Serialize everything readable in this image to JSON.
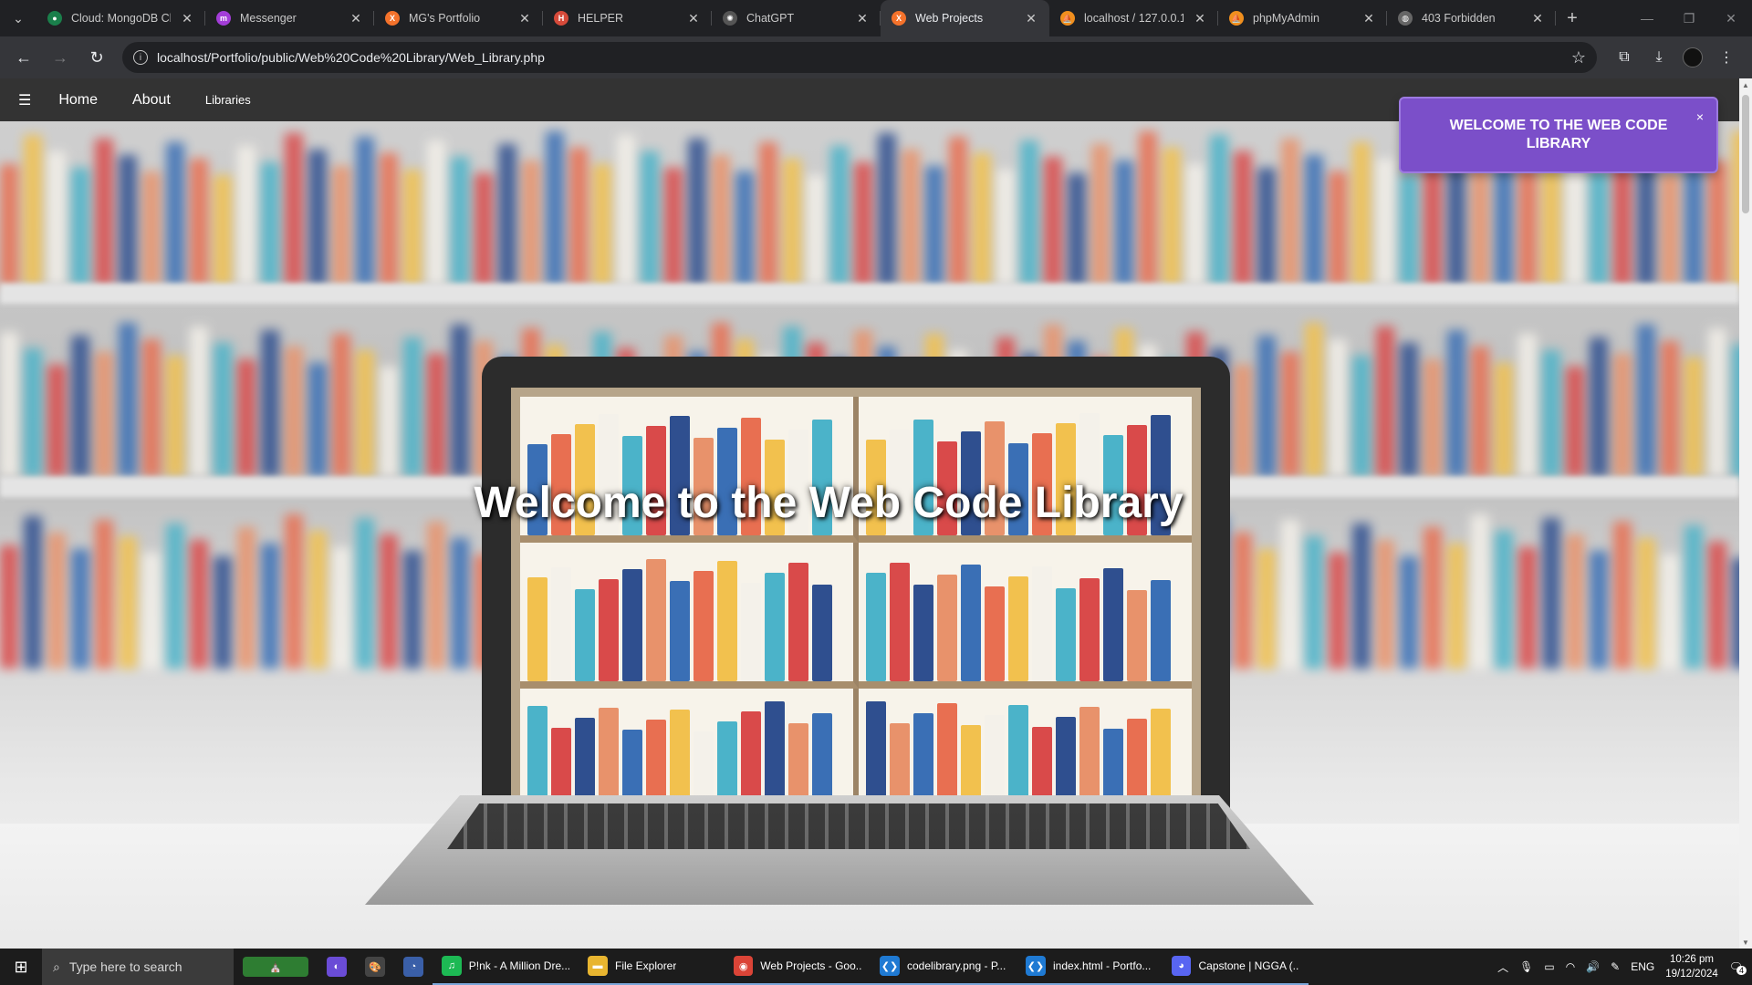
{
  "browser": {
    "tabs": [
      {
        "title": "Cloud: MongoDB Clo",
        "icon": "mongodb-leaf-icon",
        "color": "#1a7f4b",
        "glyph": "●",
        "active": false
      },
      {
        "title": "Messenger",
        "icon": "messenger-icon",
        "color": "#a33dd8",
        "glyph": "m",
        "active": false
      },
      {
        "title": "MG's Portfolio",
        "icon": "xampp-icon",
        "color": "#f4722b",
        "glyph": "X",
        "active": false
      },
      {
        "title": "HELPER",
        "icon": "brave-helper-icon",
        "color": "#d64a3a",
        "glyph": "H",
        "active": false
      },
      {
        "title": "ChatGPT",
        "icon": "chatgpt-icon",
        "color": "#555",
        "glyph": "✺",
        "active": false
      },
      {
        "title": "Web Projects",
        "icon": "xampp-icon",
        "color": "#f4722b",
        "glyph": "X",
        "active": true
      },
      {
        "title": "localhost / 127.0.0.1 /",
        "icon": "phpmyadmin-icon",
        "color": "#f08f1e",
        "glyph": "⛵",
        "active": false
      },
      {
        "title": "phpMyAdmin",
        "icon": "phpmyadmin-icon",
        "color": "#f08f1e",
        "glyph": "⛵",
        "active": false
      },
      {
        "title": "403 Forbidden",
        "icon": "globe-icon",
        "color": "#666",
        "glyph": "◍",
        "active": false
      }
    ],
    "new_tab_label": "+",
    "url": "localhost/Portfolio/public/Web%20Code%20Library/Web_Library.php"
  },
  "site": {
    "nav": {
      "menu_glyph": "☰",
      "home": "Home",
      "about": "About",
      "libraries": "Libraries"
    },
    "hero_title": "Welcome to the Web Code Library",
    "popup": {
      "message": "WELCOME TO THE WEB CODE LIBRARY",
      "close": "×"
    }
  },
  "taskbar": {
    "search_placeholder": "Type here to search",
    "apps": [
      {
        "label": "P!nk - A Million Dre...",
        "icon": "spotify-icon",
        "color": "#1db954",
        "glyph": "♫"
      },
      {
        "label": "File Explorer",
        "icon": "folder-icon",
        "color": "#e8b530",
        "glyph": "▬"
      },
      {
        "label": "Web Projects - Goo...",
        "icon": "chrome-icon",
        "color": "#db4437",
        "glyph": "◉"
      },
      {
        "label": "codelibrary.png - P...",
        "icon": "vscode-icon",
        "color": "#1f7ad3",
        "glyph": "❮❯"
      },
      {
        "label": "index.html - Portfo...",
        "icon": "vscode-icon",
        "color": "#1f7ad3",
        "glyph": "❮❯"
      },
      {
        "label": "Capstone | NGGA (...",
        "icon": "discord-icon",
        "color": "#5865f2",
        "glyph": "◕"
      }
    ],
    "language": "ENG",
    "time": "10:26 pm",
    "date": "19/12/2024",
    "notification_count": "4"
  }
}
